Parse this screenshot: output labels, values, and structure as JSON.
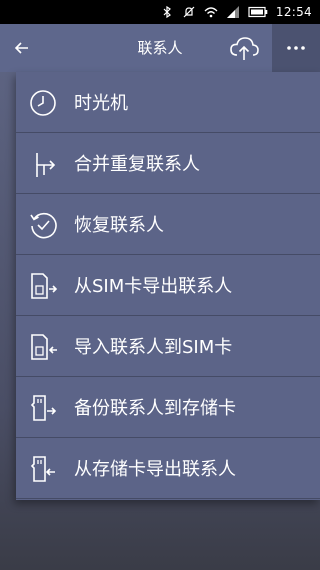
{
  "status_bar": {
    "time": "12:54",
    "icons": [
      "bluetooth-icon",
      "mute-icon",
      "wifi-icon",
      "signal-icon",
      "battery-icon"
    ]
  },
  "action_bar": {
    "title": "联系人",
    "back_icon": "arrow-left-icon",
    "cloud_icon": "cloud-upload-icon",
    "more_icon": "more-horizontal-icon"
  },
  "menu": {
    "items": [
      {
        "label": "时光机",
        "icon": "clock-icon"
      },
      {
        "label": "合并重复联系人",
        "icon": "merge-icon"
      },
      {
        "label": "恢复联系人",
        "icon": "restore-icon"
      },
      {
        "label": "从SIM卡导出联系人",
        "icon": "sim-export-icon"
      },
      {
        "label": "导入联系人到SIM卡",
        "icon": "sim-import-icon"
      },
      {
        "label": "备份联系人到存储卡",
        "icon": "sdcard-backup-icon"
      },
      {
        "label": "从存储卡导出联系人",
        "icon": "sdcard-export-icon"
      }
    ]
  },
  "colors": {
    "action_bar": "#5e678c",
    "menu_bg": "#5c6488",
    "divider": "#454b66",
    "text": "#ffffff"
  }
}
